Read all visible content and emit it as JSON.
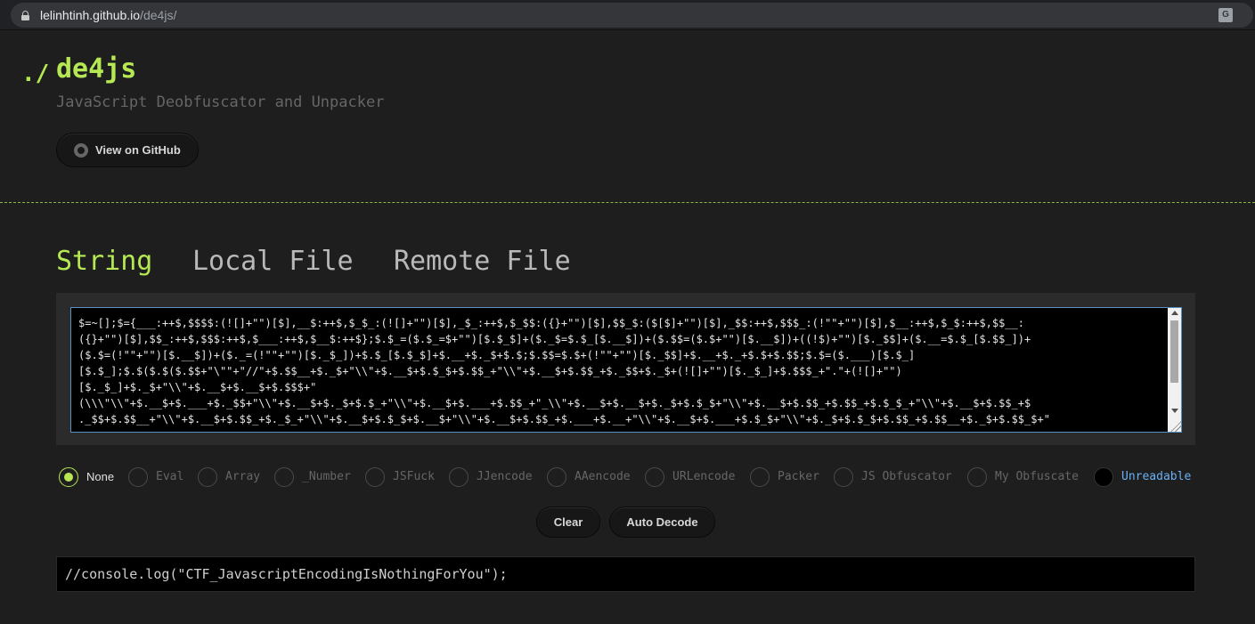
{
  "browser": {
    "url_host": "lelinhtinh.github.io",
    "url_path": "/de4js/"
  },
  "header": {
    "prefix": "./",
    "title": "de4js",
    "tagline": "JavaScript Deobfuscator and Unpacker",
    "github_button": "View on GitHub"
  },
  "tabs": [
    {
      "label": "String",
      "active": true
    },
    {
      "label": "Local File",
      "active": false
    },
    {
      "label": "Remote File",
      "active": false
    }
  ],
  "input": {
    "lines": [
      "$=~[];$={___:++$,$$$$:(![]+\"\")[$],__$:++$,$_$_:(![]+\"\")[$],_$_:++$,$_$$:({}+\"\")[$],$$_$:($[$]+\"\")[$],_$$:++$,$$$_:(!\"\"+\"\")[$],$__:++$,$_$:++$,$$__:",
      "({}+\"\")[$],$$_:++$,$$$:++$,$___:++$,$__$:++$};$.$_=($.$_=$+\"\")[$.$_$]+($._$=$.$_[$.__$])+($.$$=($.$+\"\")[$.__$])+((!$)+\"\")[$._$$]+($.__=$.$_[$.$$_])+",
      "($.$=(!\"\"+\"\")[$.__$])+($._=(!\"\"+\"\")[$._$_])+$.$_[$.$_$]+$.__+$._$+$.$;$.$$=$.$+(!\"\"+\"\")[$._$$]+$.__+$._+$.$+$.$$;$.$=($.___)[$.$_]",
      "[$.$_];$.$($.$($.$$+\"\\\"\"+\"//\"+$.$$__+$._$+\"\\\\\"+$.__$+$.$_$+$.$$_+\"\\\\\"+$.__$+$.$$_+$._$$+$._$+(![]+\"\")[$._$_]+$.$$$_+\".\"+(![]+\"\")",
      "[$._$_]+$._$+\"\\\\\"+$.__$+$.__$+$.$$$+\"",
      "(\\\\\\\"\\\\\"+$.__$+$.___+$._$$+\"\\\\\"+$.__$+$._$+$.$_+\"\\\\\"+$.__$+$.___+$.$$_+\"_\\\\\"+$.__$+$.__$+$._$+$.$_$+\"\\\\\"+$.__$+$.$$_+$.$$_+$.$_$_+\"\\\\\"+$.__$+$.$$_+$",
      "._$$+$.$$__+\"\\\\\"+$.__$+$.$$_+$._$_+\"\\\\\"+$.__$+$.$_$+$.__$+\"\\\\\"+$.__$+$.$$_+$.___+$.__+\"\\\\\"+$.__$+$.___+$.$_$+\"\\\\\"+$._$+$.$_$+$.$$_+$.$$__+$._$+$.$$_$+\""
    ]
  },
  "options": [
    {
      "label": "None",
      "selected": true
    },
    {
      "label": "Eval",
      "selected": false
    },
    {
      "label": "Array",
      "selected": false
    },
    {
      "label": "_Number",
      "selected": false
    },
    {
      "label": "JSFuck",
      "selected": false
    },
    {
      "label": "JJencode",
      "selected": false
    },
    {
      "label": "AAencode",
      "selected": false
    },
    {
      "label": "URLencode",
      "selected": false
    },
    {
      "label": "Packer",
      "selected": false
    },
    {
      "label": "JS Obfuscator",
      "selected": false
    },
    {
      "label": "My Obfuscate",
      "selected": false
    },
    {
      "label": "Unreadable",
      "selected": false
    }
  ],
  "actions": {
    "clear": "Clear",
    "auto_decode": "Auto Decode"
  },
  "output": {
    "text": "//console.log(\"CTF_JavascriptEncodingIsNothingForYou\");"
  },
  "colors": {
    "accent": "#b5e853",
    "background": "#1e1e1e",
    "link": "#6ab0f3"
  }
}
